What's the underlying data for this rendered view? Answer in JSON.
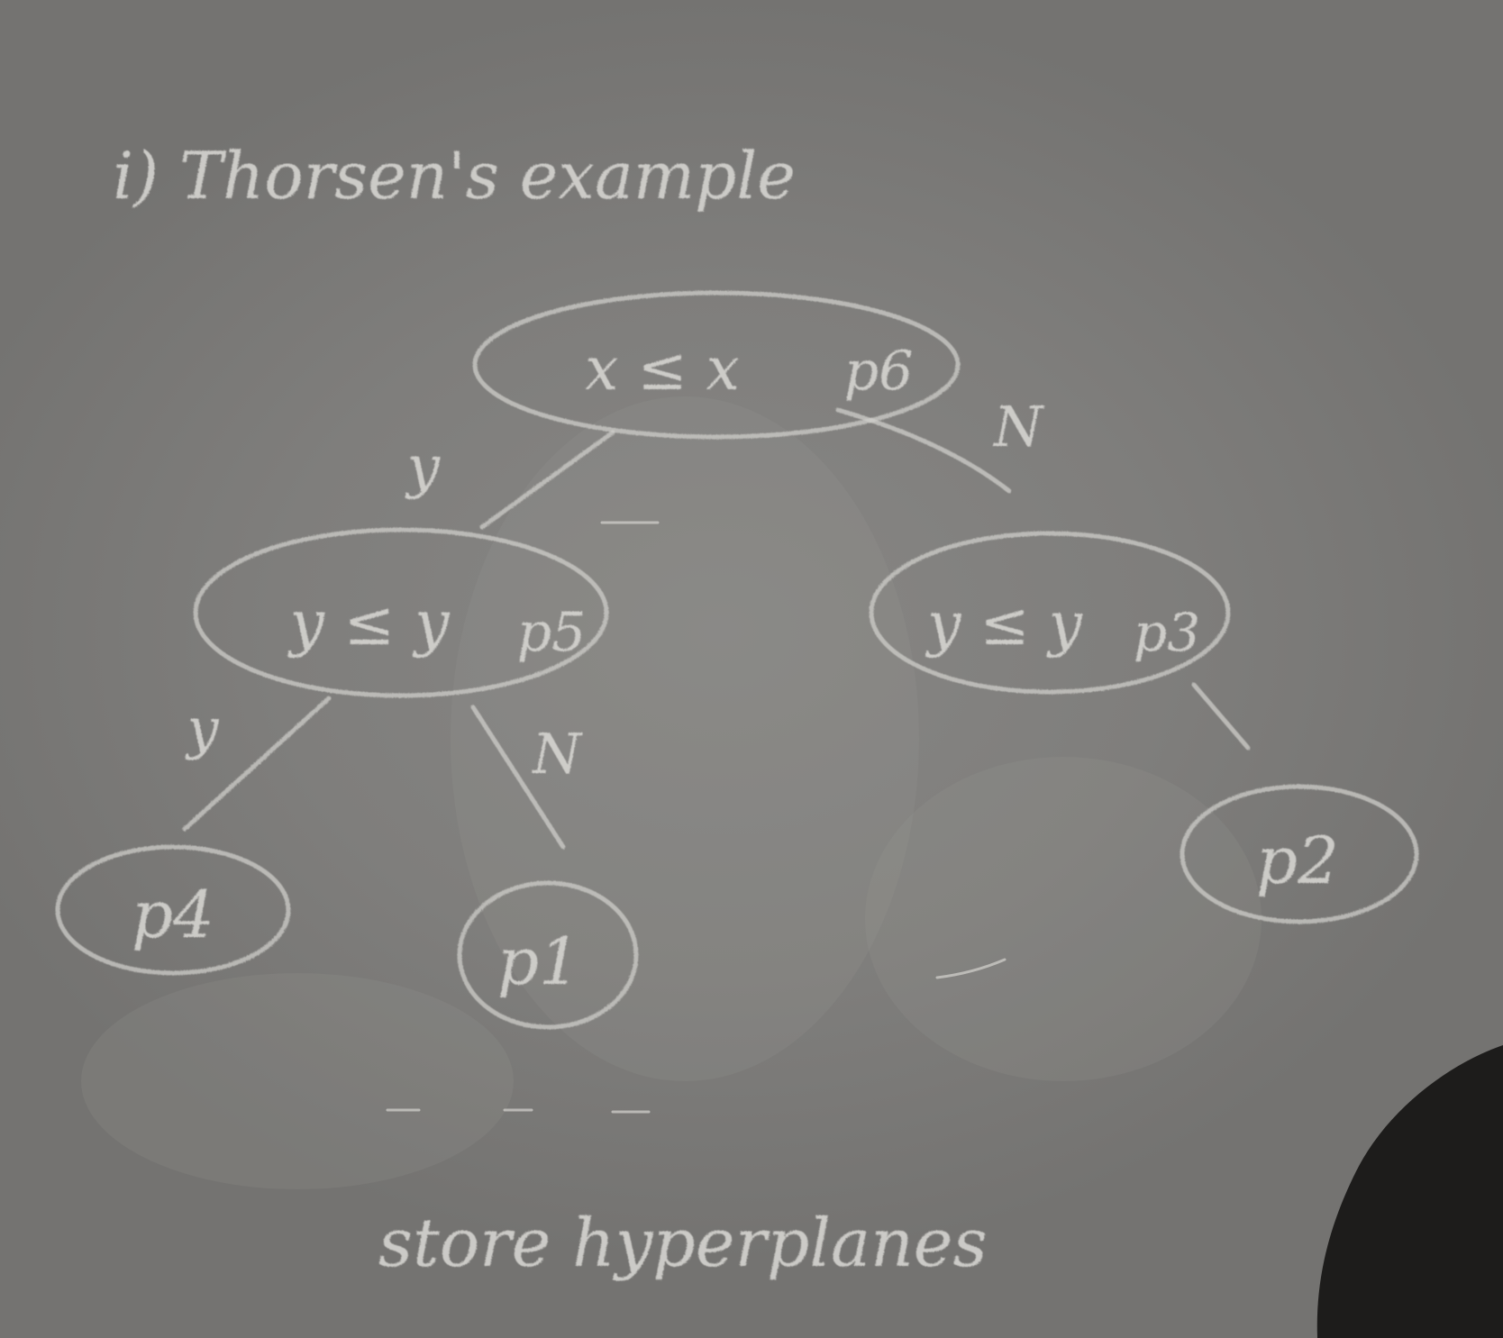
{
  "title": "i) Thorsen's example",
  "tree": {
    "root": {
      "label": "x ≤ x",
      "point": "p6"
    },
    "left": {
      "label": "y ≤ y",
      "point": "p5"
    },
    "right": {
      "label": "y ≤ y",
      "point": "p3"
    },
    "leaves": {
      "left_left": "p4",
      "left_right": "p1",
      "right_right": "p2"
    },
    "edge_labels": {
      "root_left": "y",
      "root_right": "N",
      "left_left": "y",
      "left_right": "N"
    }
  },
  "caption": "store hyperplanes"
}
